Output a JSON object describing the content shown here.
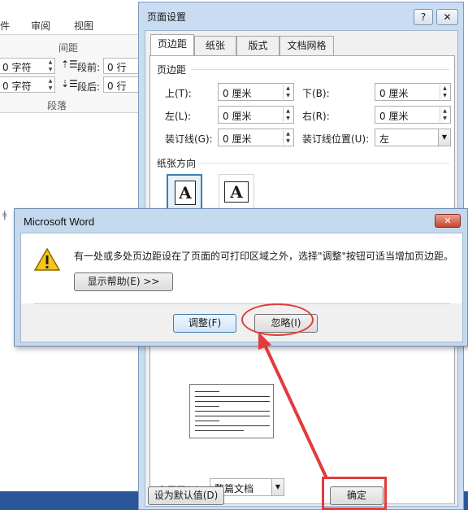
{
  "ribbon": {
    "tab_partial": "件",
    "tab_review": "审阅",
    "tab_view": "视图",
    "spacing_label": "间距",
    "paragraph_label": "段落",
    "indent_left_value": "0 字符",
    "indent_right_value": "0 字符",
    "space_before_label": "段前:",
    "space_after_label": "段后:",
    "space_before_value": "0 行",
    "space_after_value": "0 行"
  },
  "page_setup": {
    "title": "页面设置",
    "help_glyph": "?",
    "close_glyph": "✕",
    "tabs": [
      {
        "label": "页边距"
      },
      {
        "label": "纸张"
      },
      {
        "label": "版式"
      },
      {
        "label": "文档网格"
      }
    ],
    "margins_section": "页边距",
    "top_label": "上(T):",
    "bottom_label": "下(B):",
    "left_label": "左(L):",
    "right_label": "右(R):",
    "gutter_label": "装订线(G):",
    "gutter_pos_label": "装订线位置(U):",
    "top_value": "0 厘米",
    "bottom_value": "0 厘米",
    "left_value": "0 厘米",
    "right_value": "0 厘米",
    "gutter_value": "0 厘米",
    "gutter_pos_value": "左",
    "orientation_section": "纸张方向",
    "portrait_glyph": "A",
    "landscape_glyph": "A",
    "apply_label": "应用于(Y):",
    "apply_value": "整篇文档",
    "set_default_label": "设为默认值(D)",
    "ok_label": "确定"
  },
  "message_box": {
    "title": "Microsoft Word",
    "close_glyph": "✕",
    "message": "有一处或多处页边距设在了页面的可打印区域之外，选择\"调整\"按钮可适当增加页边距。",
    "show_help_label": "显示帮助(E) >>",
    "adjust_label": "调整(F)",
    "ignore_label": "忽略(I)"
  },
  "colors": {
    "annotation_red": "#e23b3b",
    "word_blue": "#2b579a",
    "dialog_frame": "#c9dcf1"
  }
}
